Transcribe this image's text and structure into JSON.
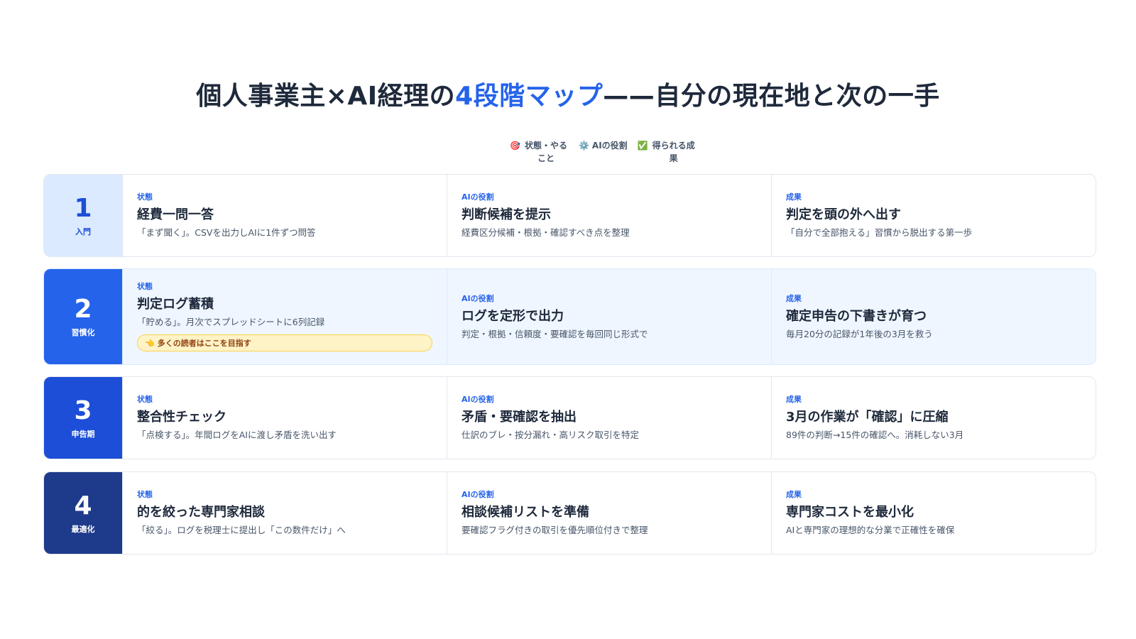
{
  "title": {
    "prefix": "個人事業主×AI経理の",
    "highlight": "4段階マップ",
    "suffix": "——自分の現在地と次の一手"
  },
  "legend": [
    {
      "icon": "🎯",
      "icon_name": "target-icon",
      "label": "状態・やること"
    },
    {
      "icon": "⚙️",
      "icon_name": "gear-icon",
      "label": "AIの役割"
    },
    {
      "icon": "✅",
      "icon_name": "check-icon",
      "label": "得られる成果"
    }
  ],
  "rows": [
    {
      "num": "1",
      "label": "入門",
      "stage_bg": "#dbeafe",
      "stage_fg": "#1d4ed8",
      "highlight": false,
      "state": {
        "tag": "状態",
        "title": "経費一問一答",
        "desc": "「まず聞く」。CSVを出力しAIに1件ずつ問答"
      },
      "ai": {
        "tag": "AIの役割",
        "title": "判断候補を提示",
        "desc": "経費区分候補・根拠・確認すべき点を整理"
      },
      "result": {
        "tag": "成果",
        "title": "判定を頭の外へ出す",
        "desc": "「自分で全部抱える」習慣から脱出する第一歩"
      }
    },
    {
      "num": "2",
      "label": "習慣化",
      "stage_bg": "#2563eb",
      "stage_fg": "#ffffff",
      "highlight": true,
      "state": {
        "tag": "状態",
        "title": "判定ログ蓄積",
        "desc": "「貯める」。月次でスプレッドシートに6列記録",
        "badge_icon": "👈",
        "badge": "多くの読者はここを目指す"
      },
      "ai": {
        "tag": "AIの役割",
        "title": "ログを定形で出力",
        "desc": "判定・根拠・信頼度・要確認を毎回同じ形式で"
      },
      "result": {
        "tag": "成果",
        "title": "確定申告の下書きが育つ",
        "desc": "毎月20分の記録が1年後の3月を救う"
      }
    },
    {
      "num": "3",
      "label": "申告期",
      "stage_bg": "#1d4ed8",
      "stage_fg": "#ffffff",
      "highlight": false,
      "state": {
        "tag": "状態",
        "title": "整合性チェック",
        "desc": "「点検する」。年間ログをAIに渡し矛盾を洗い出す"
      },
      "ai": {
        "tag": "AIの役割",
        "title": "矛盾・要確認を抽出",
        "desc": "仕訳のブレ・按分漏れ・高リスク取引を特定"
      },
      "result": {
        "tag": "成果",
        "title": "3月の作業が「確認」に圧縮",
        "desc": "89件の判断→15件の確認へ。消耗しない3月"
      }
    },
    {
      "num": "4",
      "label": "最適化",
      "stage_bg": "#1e3a8a",
      "stage_fg": "#ffffff",
      "highlight": false,
      "state": {
        "tag": "状態",
        "title": "的を絞った専門家相談",
        "desc": "「絞る」。ログを税理士に提出し「この数件だけ」へ"
      },
      "ai": {
        "tag": "AIの役割",
        "title": "相談候補リストを準備",
        "desc": "要確認フラグ付きの取引を優先順位付きで整理"
      },
      "result": {
        "tag": "成果",
        "title": "専門家コストを最小化",
        "desc": "AIと専門家の理想的な分業で正確性を確保"
      }
    }
  ]
}
